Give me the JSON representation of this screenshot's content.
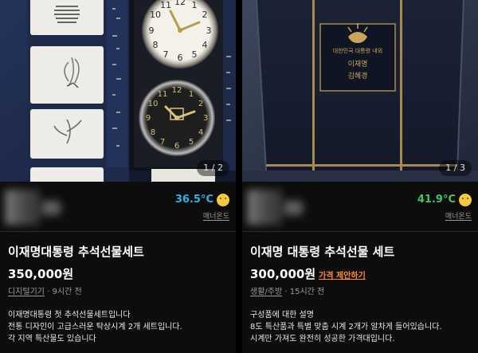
{
  "listings": [
    {
      "photo_counter": "1 / 2",
      "manner_temp": "36.5°C",
      "manner_color": "#2bb3e6",
      "manner_label": "매너온도",
      "title": "이재명대통령 추석선물세트",
      "price": "350,000원",
      "category": "디지털기기",
      "time_ago": "9시간 전",
      "description": [
        "이재명대통령 첫 추석선물세트입니다",
        "전통 디자인이 고급스러운 탁상시계 2개 세트입니다.",
        "각 지역 특산물도 있습니다"
      ],
      "clock_numbers": [
        "12",
        "1",
        "2",
        "3",
        "4",
        "5",
        "6",
        "7",
        "8",
        "9",
        "10",
        "11"
      ]
    },
    {
      "photo_counter": "1 / 3",
      "manner_temp": "41.9°C",
      "manner_color": "#44c36a",
      "manner_label": "매너온도",
      "title": "이재명 대통령 추석선물 세트",
      "price": "300,000원",
      "price_offer": "가격 제안하기",
      "category": "생활/주방",
      "time_ago": "15시간 전",
      "description": [
        "구성품에 대한 설명",
        "8도 특산품과 특별 맞춤 시계 2개가 알차게 들어있습니다.",
        "시계만 가져도 완전히 성공한 가격대입니다."
      ],
      "box_label_line1": "대한민국 대통령 내외",
      "box_label_line2": "이재명",
      "box_label_line3": "김혜경"
    }
  ]
}
